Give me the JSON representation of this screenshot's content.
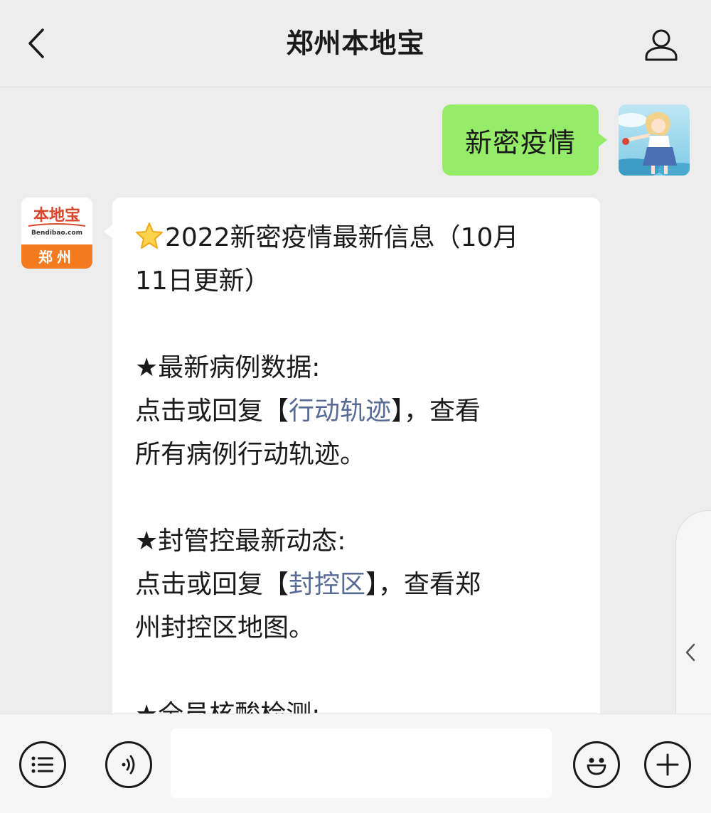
{
  "header": {
    "title": "郑州本地宝",
    "back_icon": "chevron-left-icon",
    "profile_icon": "person-icon"
  },
  "chat": {
    "outgoing": {
      "text": "新密疫情",
      "avatar": "anime-girl-avatar"
    },
    "incoming": {
      "avatar_text_top": "本地宝",
      "avatar_text_sub": "Bendibao.com",
      "avatar_text_city": "郑州",
      "heading_line1": "2022新密疫情最新信息（10月",
      "heading_line2": "11日更新）",
      "section1_title": "★最新病例数据:",
      "section1_l1_pre": "点击或回复【",
      "section1_link": "行动轨迹",
      "section1_l1_post": "】，查看",
      "section1_l2": "所有病例行动轨迹。",
      "section2_title": "★封管控最新动态:",
      "section2_l1_pre": "点击或回复【",
      "section2_link": "封控区",
      "section2_l1_post": "】，查看郑",
      "section2_l2": "州封控区地图。",
      "section3_title": "★全员核酸检测:"
    }
  },
  "bottom_bar": {
    "menu_icon": "menu-list-icon",
    "voice_icon": "voice-icon",
    "emoji_icon": "smiley-icon",
    "add_icon": "plus-icon",
    "input_value": ""
  },
  "colors": {
    "outgoing_bubble": "#95ec69",
    "link": "#576b95",
    "background": "#ededed",
    "avatar_orange": "#f47a20"
  }
}
